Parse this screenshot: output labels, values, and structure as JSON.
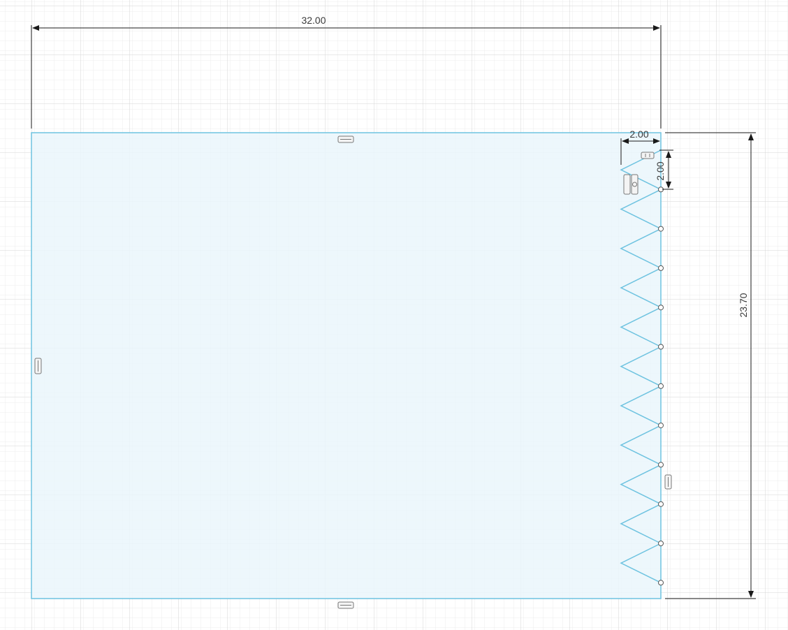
{
  "dimensions": {
    "width_label": "32.00",
    "height_label": "23.70",
    "tooth_width_label": "2.00",
    "tooth_height_label": "2.00"
  },
  "sketch": {
    "profile_color": "#6ec3e0",
    "fill_color": "#eef8fc",
    "dimension_color": "#1a1a1a",
    "tooth_count": 11
  },
  "icons": {
    "constraint_icons": [
      "horizontal-constraint-icon",
      "vertical-constraint-icon",
      "coincident-constraint-icon",
      "parallel-constraint-icon"
    ]
  }
}
